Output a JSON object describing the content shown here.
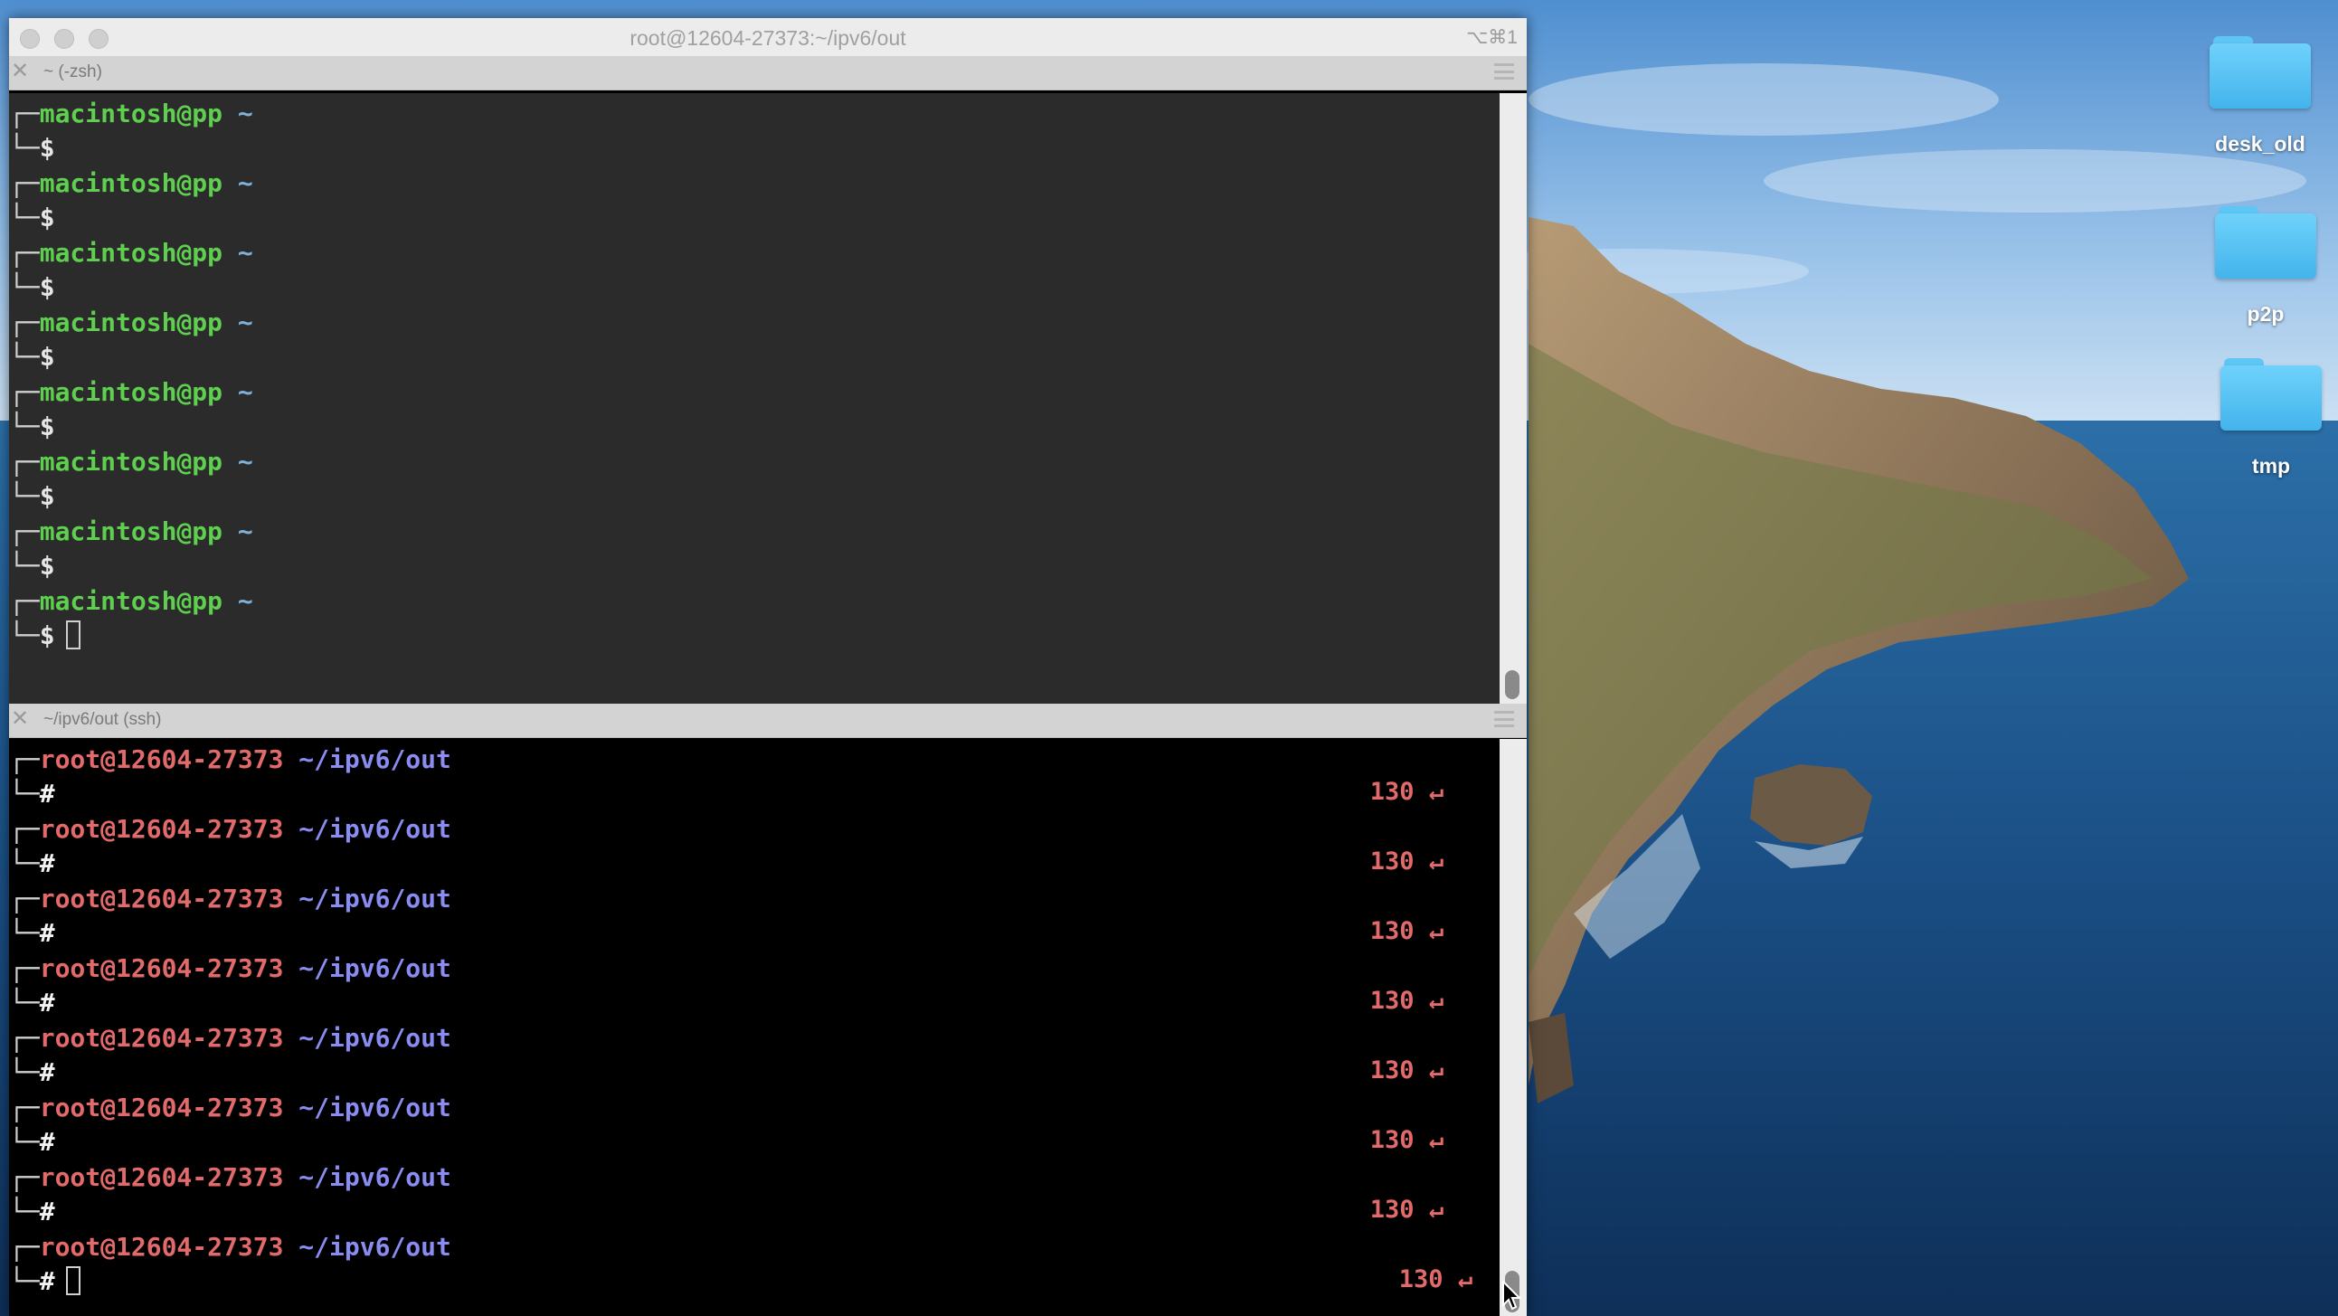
{
  "window": {
    "title": "root@12604-27373:~/ipv6/out",
    "shortcut": "⌥⌘1"
  },
  "pane_top": {
    "label": "~ (-zsh)",
    "user": "macintosh@pp",
    "dir": "~",
    "symbol": "$",
    "prompt_count": 8
  },
  "pane_bottom": {
    "label": "~/ipv6/out (ssh)",
    "user": "root@12604-27373",
    "dir": "~/ipv6/out",
    "symbol": "#",
    "status": "130 ↵",
    "prompt_count": 8
  },
  "desktop": {
    "icons": [
      {
        "label": "desk_old",
        "icon": "folder-icon"
      },
      {
        "label": "p2p",
        "icon": "folder-icon"
      },
      {
        "label": "tmp",
        "icon": "folder-icon"
      }
    ]
  },
  "colors": {
    "zsh_user": "#5fcf4f",
    "ssh_user": "#e36a6a",
    "ssh_path": "#8a8cf2",
    "status": "#e36a6a"
  }
}
